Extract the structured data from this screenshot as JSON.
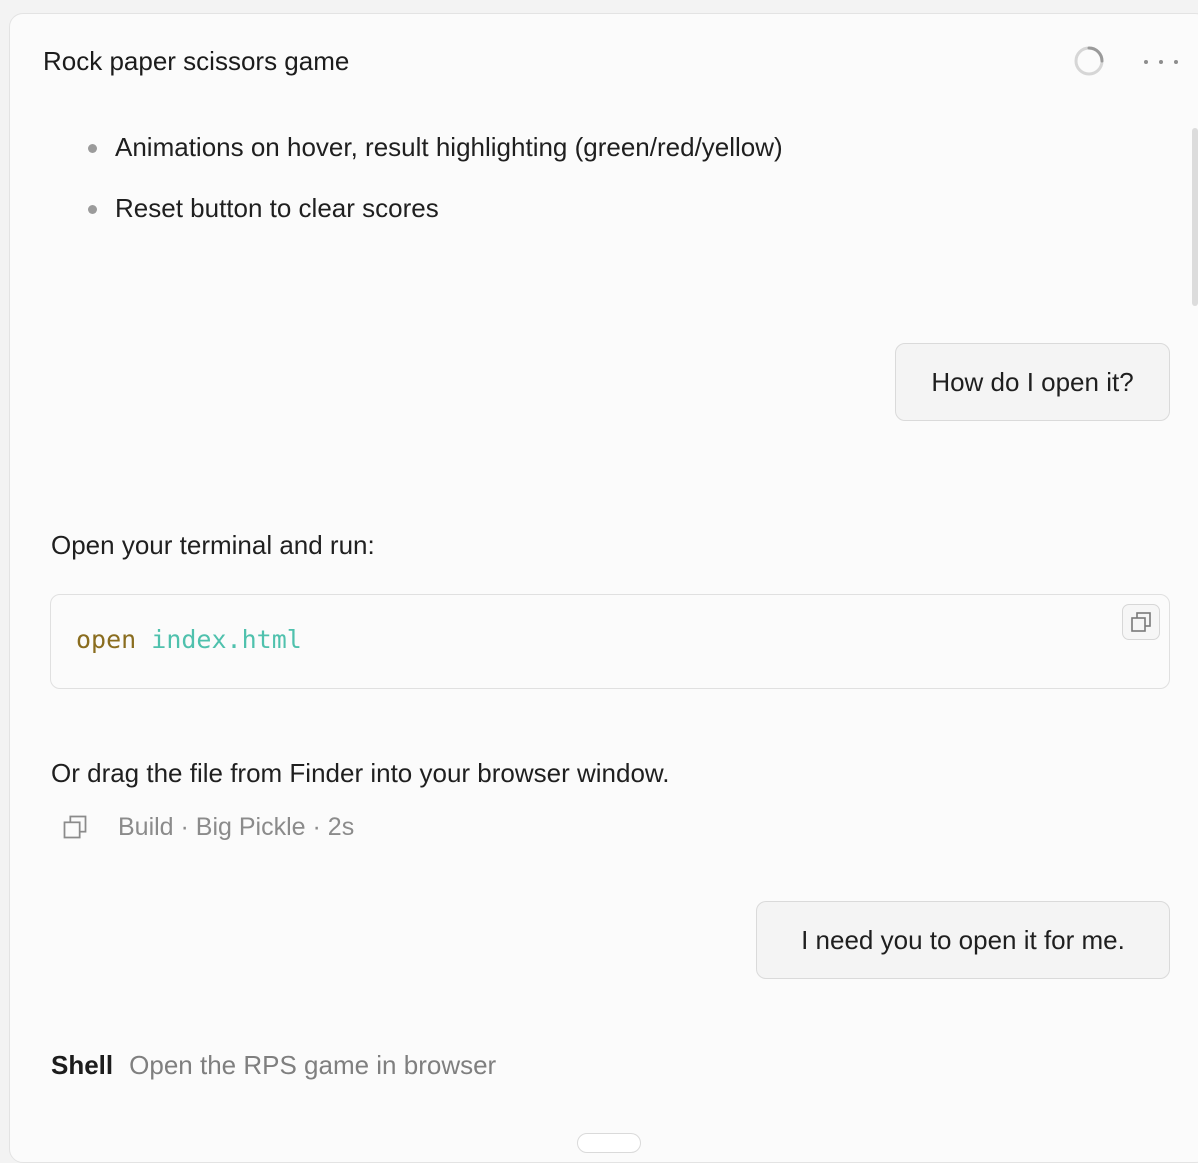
{
  "header": {
    "title": "Rock paper scissors game",
    "status_icon": "loading-spinner-icon",
    "more_icon": "more-horizontal-icon"
  },
  "assistant_prev": {
    "bullets": [
      "Animations on hover, result highlighting (green/red/yellow)",
      "Reset button to clear scores"
    ]
  },
  "user_message_1": "How do I open it?",
  "assistant_reply": {
    "intro": "Open your terminal and run:",
    "code": {
      "command": "open",
      "argument": "index.html",
      "copy_icon": "copy-icon"
    },
    "outro": "Or drag the file from Finder into your browser window.",
    "meta": {
      "copy_icon": "copy-icon",
      "text": "Build · Big Pickle · 2s"
    }
  },
  "user_message_2": "I need you to open it for me.",
  "tool_call": {
    "label": "Shell",
    "description": "Open the RPS game in browser"
  },
  "colors": {
    "code_command": "#8a6d1f",
    "code_argument": "#4fc1ad",
    "background": "#fbfbfb"
  }
}
